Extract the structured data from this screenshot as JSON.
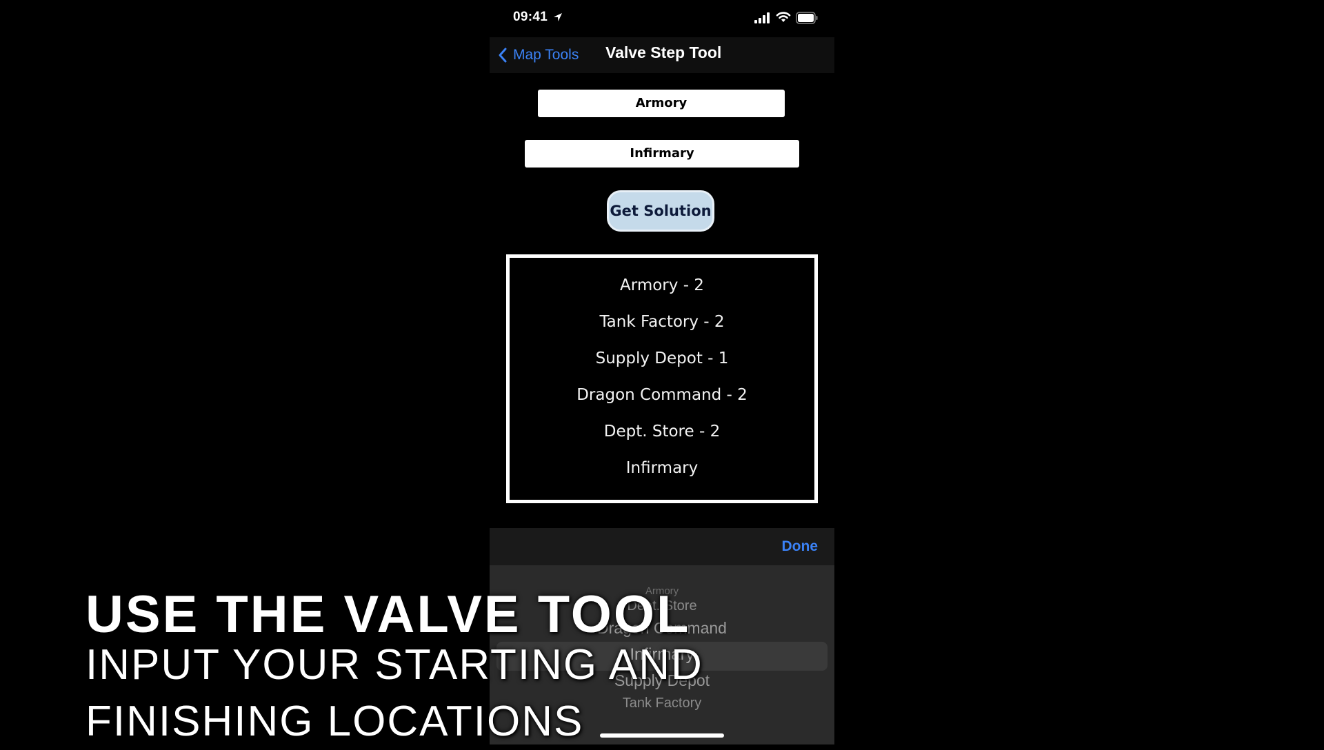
{
  "status_bar": {
    "time": "09:41"
  },
  "nav": {
    "back_label": "Map Tools",
    "title": "Valve Step Tool"
  },
  "form": {
    "start_value": "Armory",
    "end_value": "Infirmary",
    "solve_label": "Get Solution"
  },
  "solution": [
    "Armory - 2",
    "Tank Factory - 2",
    "Supply Depot - 1",
    "Dragon Command - 2",
    "Dept. Store - 2",
    "Infirmary"
  ],
  "picker": {
    "done_label": "Done",
    "options": [
      "Armory",
      "Dept. Store",
      "Dragon Command",
      "Infirmary",
      "Supply Depot",
      "Tank Factory"
    ],
    "selected": "Infirmary"
  },
  "captions": {
    "title": "USE THE VALVE TOOL",
    "subtitle": "INPUT YOUR STARTING AND FINISHING LOCATIONS"
  },
  "colors": {
    "accent": "#3b82f6",
    "button_bg": "#c5daea",
    "button_text": "#0d1a3a"
  }
}
